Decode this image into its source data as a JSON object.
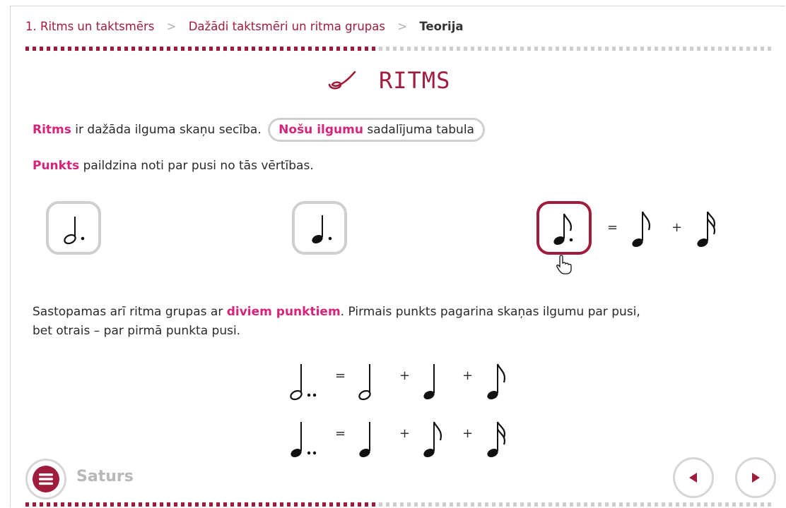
{
  "breadcrumb": {
    "item1": "1. Ritms un taktsmērs",
    "sep": ">",
    "item2": "Dažādi taktsmēri un ritma grupas",
    "current": "Teorija"
  },
  "title": "RITMS",
  "intro": {
    "term": "Ritms",
    "text": " ir dažāda ilguma skaņu secība.",
    "button_term": "Nošu ilgumu",
    "button_rest": " sadalījuma tabula"
  },
  "dot_rule": {
    "term": "Punkts",
    "text": " paildzina noti par pusi no tās vērtības."
  },
  "double_dot": {
    "text_before": "Sastopamas arī ritma grupas ar ",
    "term": "diviem punktiem",
    "text_after": ". Pirmais punkts pagarina skaņas ilgumu par pusi,",
    "line2": "bet otrais – par pirmā punkta pusi."
  },
  "symbols": {
    "equals": "=",
    "plus": "+"
  },
  "notes": {
    "box1": "dotted-half-note",
    "box2": "dotted-quarter-note",
    "box3": "dotted-eighth-note",
    "eq1": [
      "eighth-note",
      "sixteenth-note"
    ],
    "row1": [
      "double-dotted-half-note",
      "half-note",
      "quarter-note",
      "eighth-note"
    ],
    "row2": [
      "double-dotted-quarter-note",
      "quarter-note",
      "eighth-note",
      "sixteenth-note"
    ]
  },
  "footer": {
    "menu_label": "Saturs"
  },
  "colors": {
    "accent": "#a01c3c",
    "term": "#d6247a",
    "border": "#cfcfcf"
  }
}
